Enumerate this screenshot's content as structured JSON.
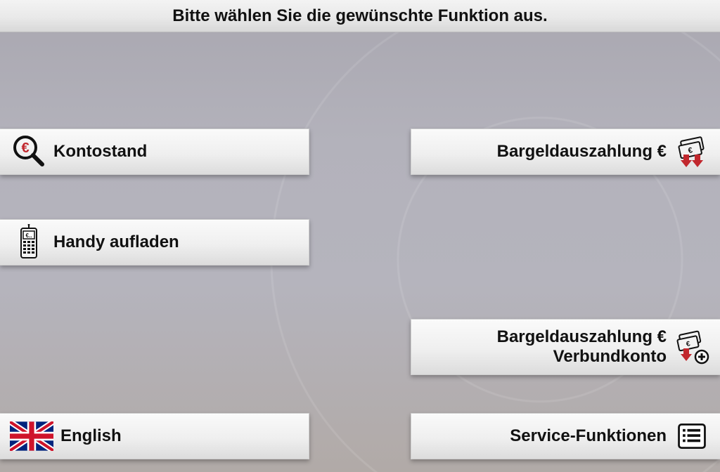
{
  "header": {
    "title": "Bitte wählen Sie die gewünschte Funktion aus."
  },
  "buttons": {
    "balance": {
      "label": "Kontostand"
    },
    "withdraw": {
      "label": "Bargeldauszahlung €"
    },
    "topup": {
      "label": "Handy aufladen"
    },
    "withdraw_linked": {
      "label": "Bargeldauszahlung €\nVerbundkonto"
    },
    "english": {
      "label": "English"
    },
    "service": {
      "label": "Service-Funktionen"
    }
  }
}
